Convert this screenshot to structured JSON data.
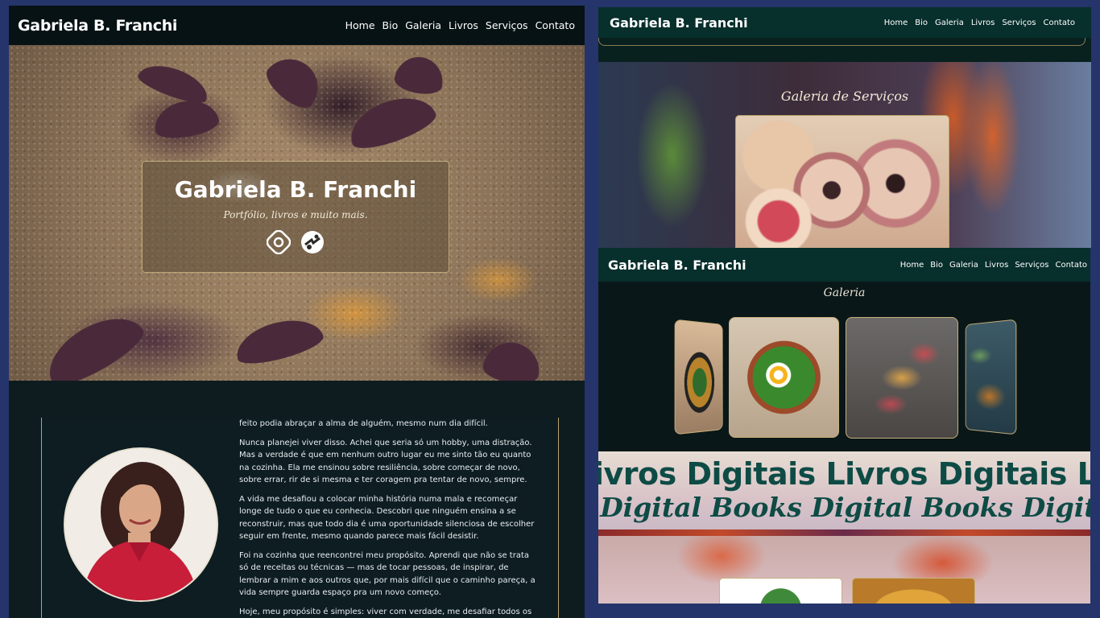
{
  "left": {
    "brand": "Gabriela B. Franchi",
    "nav": [
      "Home",
      "Bio",
      "Galeria",
      "Livros",
      "Serviços",
      "Contato"
    ],
    "hero": {
      "title": "Gabriela B. Franchi",
      "subtitle": "Portfólio, livros e muito mais.",
      "icons": [
        "instagram-icon",
        "globe-icon"
      ]
    },
    "bio": {
      "paragraphs": [
        "feito podia abraçar a alma de alguém, mesmo num dia difícil.",
        "Nunca planejei viver disso. Achei que seria só um hobby, uma distração. Mas a verdade é que em nenhum outro lugar eu me sinto tão eu quanto na cozinha. Ela me ensinou sobre resiliência, sobre começar de novo, sobre errar, rir de si mesma e ter coragem pra tentar de novo, sempre.",
        "A vida me desafiou a colocar minha história numa mala e recomeçar longe de tudo o que eu conhecia. Descobri que ninguém ensina a se reconstruir, mas que todo dia é uma oportunidade silenciosa de escolher seguir em frente, mesmo quando parece mais fácil desistir.",
        "Foi na cozinha que reencontrei meu propósito. Aprendi que não se trata só de receitas ou técnicas — mas de tocar pessoas, de inspirar, de lembrar a mim e aos outros que, por mais difícil que o caminho pareça, a vida sempre guarda espaço pra um novo começo.",
        "Hoje, meu propósito é simples: viver com verdade, me desafiar todos os"
      ]
    }
  },
  "right_top": {
    "brand": "Gabriela B. Franchi",
    "nav": [
      "Home",
      "Bio",
      "Galeria",
      "Livros",
      "Serviços",
      "Contato"
    ],
    "section_title": "Galeria de Serviços"
  },
  "right_bottom": {
    "brand": "Gabriela B. Franchi",
    "nav": [
      "Home",
      "Bio",
      "Galeria",
      "Livros",
      "Serviços",
      "Contato"
    ],
    "gallery_title": "Galeria",
    "marquee_line1": "ivros Digitais Livros Digitais Livros Digitais Liv",
    "marquee_line2": "s Digital Books Digital Books Digital B"
  },
  "colors": {
    "page_bg": "#25346a",
    "nav_dark": "#071214",
    "nav_teal": "#072f2c",
    "gold_border": "#b9a46a",
    "marquee_text": "#0e4b45"
  }
}
